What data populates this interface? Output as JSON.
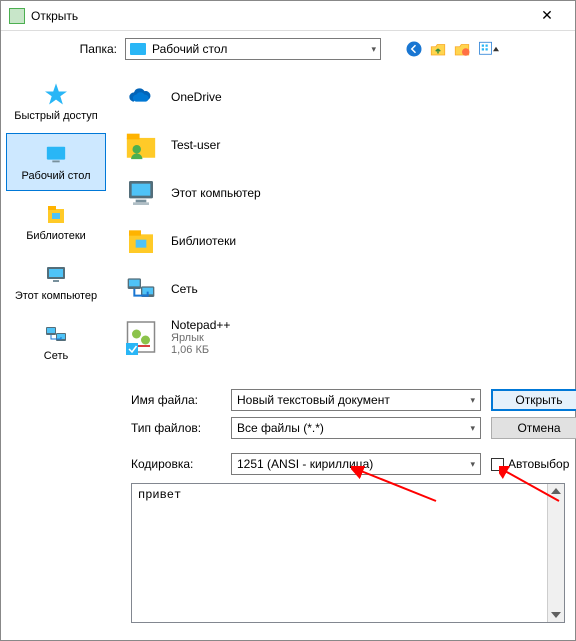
{
  "title": "Открыть",
  "folder": {
    "label": "Папка:",
    "value": "Рабочий стол"
  },
  "toolbar": {
    "back": "back-icon",
    "up": "up-icon",
    "newfolder": "newfolder-icon",
    "views": "views-icon"
  },
  "places": [
    {
      "label": "Быстрый доступ",
      "icon": "star"
    },
    {
      "label": "Рабочий стол",
      "icon": "desktop",
      "selected": true
    },
    {
      "label": "Библиотеки",
      "icon": "libraries"
    },
    {
      "label": "Этот компьютер",
      "icon": "computer"
    },
    {
      "label": "Сеть",
      "icon": "network"
    }
  ],
  "files": [
    {
      "name": "OneDrive",
      "icon": "onedrive"
    },
    {
      "name": "Test-user",
      "icon": "user"
    },
    {
      "name": "Этот компьютер",
      "icon": "computer-big"
    },
    {
      "name": "Библиотеки",
      "icon": "libraries-big"
    },
    {
      "name": "Сеть",
      "icon": "network-big"
    },
    {
      "name": "Notepad++",
      "sub1": "Ярлык",
      "sub2": "1,06 КБ",
      "icon": "npp"
    }
  ],
  "form": {
    "filename_label": "Имя файла:",
    "filename_value": "Новый текстовый документ",
    "filetype_label": "Тип файлов:",
    "filetype_value": "Все файлы (*.*)",
    "open_btn": "Открыть",
    "cancel_btn": "Отмена"
  },
  "encoding": {
    "label": "Кодировка:",
    "value": "1251  (ANSI - кириллица)",
    "auto_label": "Автовыбор"
  },
  "preview_text": "привет"
}
